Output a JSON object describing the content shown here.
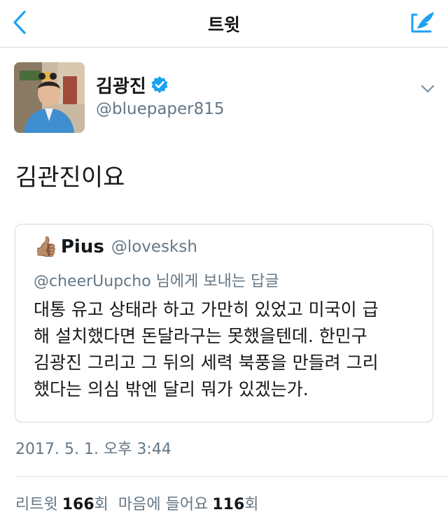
{
  "nav": {
    "title": "트윗",
    "back_icon": "chevron-left-icon",
    "compose_icon": "compose-tweet-icon",
    "accent": "#1da1f2"
  },
  "author": {
    "name": "김광진",
    "handle": "@bluepaper815",
    "verified": true
  },
  "tweet": {
    "text": "김관진이요"
  },
  "quote": {
    "emoji": "👍🏽",
    "name": "Pius",
    "handle": "@lovesksh",
    "reply_to": "@cheerUupcho 님에게 보내는 답글",
    "lines": [
      "대통 유고 상태라 하고 가만히 있었고 미국이 급",
      "해 설치했다면 돈달라구는 못했을텐데. 한민구",
      "김광진 그리고 그 뒤의 세력 북풍을 만들려 그리",
      "했다는 의심 밖엔 달리 뭐가 있겠는가."
    ]
  },
  "timestamp": "2017. 5. 1. 오후 3:44",
  "stats": {
    "retweet_label": "리트윗",
    "retweet_count": "166",
    "retweet_suffix": "회",
    "like_label": "마음에 들어요",
    "like_count": "116",
    "like_suffix": "회"
  }
}
